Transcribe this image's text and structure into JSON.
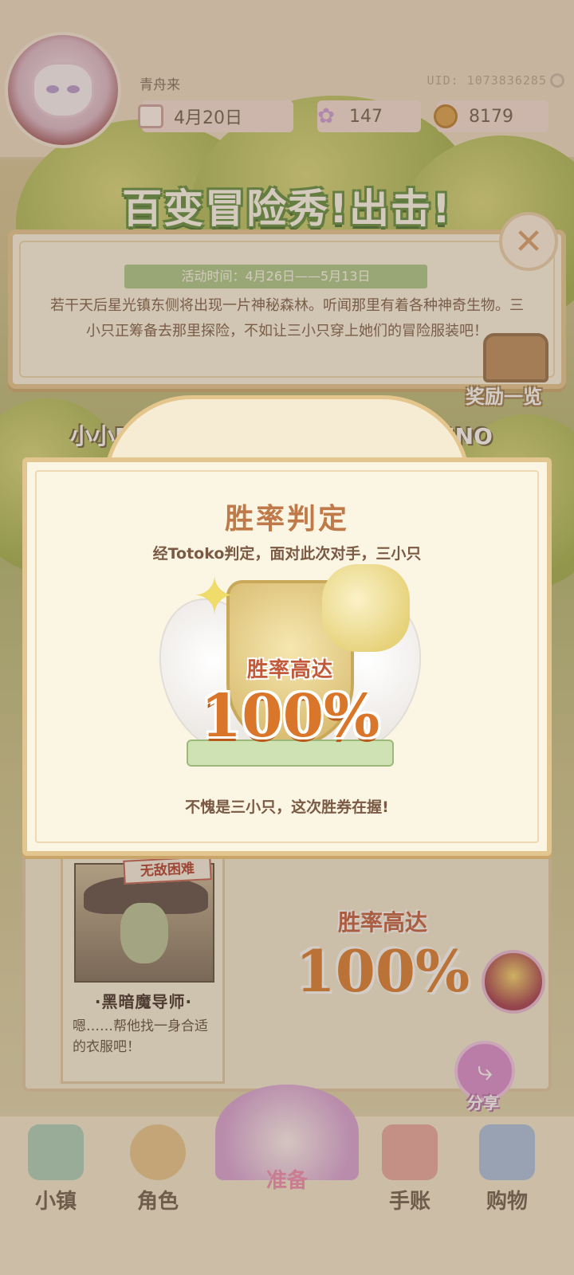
{
  "header": {
    "username": "青舟来",
    "uid": "UID: 1073836285",
    "date": "4月20日",
    "gems": "147",
    "coins": "8179"
  },
  "event": {
    "title": "百变冒险秀!出击!",
    "time": "活动时间：4月26日——5月13日",
    "description": "若干天后星光镇东侧将出现一片神秘森林。听闻那里有着各种神奇生物。三小只正筹备去那里探险，不如让三小只穿上她们的冒险服装吧！",
    "reward_label": "奖励一览",
    "team_left": "小小Ro...",
    "team_right": "...小UNO"
  },
  "enemy": {
    "tag": "无敌困难",
    "name": "·黑暗魔导师·",
    "desc": "嗯……帮他找一身合适的衣服吧！"
  },
  "background_rate": {
    "label": "胜率高达",
    "value": "100%"
  },
  "dialog": {
    "title": "胜率判定",
    "subtitle": "经Totoko判定，面对此次对手，三小只",
    "rate_label": "胜率高达",
    "rate_value": "100%",
    "footer": "不愧是三小只，这次胜券在握!"
  },
  "share_label": "分享",
  "nav": [
    {
      "label": "小镇",
      "icon": "town-map-icon"
    },
    {
      "label": "角色",
      "icon": "character-icon"
    },
    {
      "label": "准备",
      "icon": "prepare-icon"
    },
    {
      "label": "手账",
      "icon": "journal-icon"
    },
    {
      "label": "购物",
      "icon": "shopping-bag-icon"
    }
  ],
  "colors": {
    "accent_title": "#c07a4a",
    "rate_orange": "#d9762a",
    "nav_active": "#f08ab0"
  }
}
